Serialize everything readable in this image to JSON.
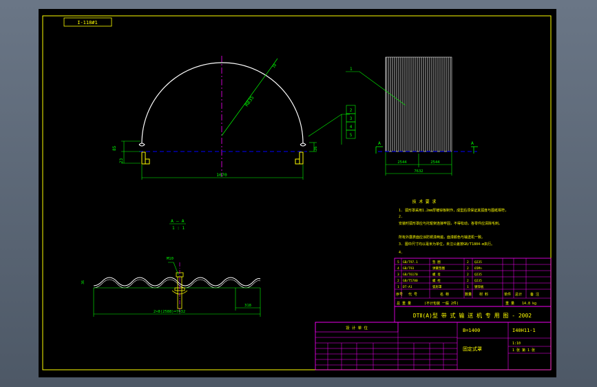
{
  "colors": {
    "frame": "#ffff00",
    "arc": "#ffffff",
    "green": "#00ff00",
    "center": "#ff00ff",
    "dash": "#0000ff",
    "table": "#ff00ff",
    "text": "#ffff00",
    "bg": "#000000",
    "desk": "#5a6676"
  },
  "drawing": {
    "code_box": "I-118#1",
    "dim_width": "1670",
    "dim_radius": "R835",
    "dim_left_1": "85",
    "dim_left_2": "23",
    "dim_right": "26",
    "dim_top_small": "10",
    "dim_plate_half_1": "2544",
    "dim_plate_half_2": "2544",
    "dim_plate_total": "7632",
    "section_mark_left": "A",
    "section_mark_right": "A",
    "section_title": "A — A",
    "section_scale": "1 : 1",
    "bolt_label": "M10",
    "wave_dim": "2×8(2588)=7632",
    "wave_end_dim": "318",
    "wave_height": "36",
    "callouts": [
      "1",
      "2",
      "3",
      "4",
      "5"
    ]
  },
  "notes": {
    "title": "技 术 要 求",
    "lines": [
      "1. 弧形罩采用1.2mm厚镀锌板制作，成型后须保证其弧度与图纸相符，",
      "2.",
      "   安装时弧形罩应与托辊架连接牢固，不得松动，各零件应清除毛刺。",
      "   所有外露表面应涂防锈漆两遍，面漆颜色与输送机一致。",
      "3. 图中尺寸均以毫米为单位，未注公差按GB/T1804-m执行。",
      "4."
    ]
  },
  "parts_table": {
    "rows": [
      [
        "5",
        "GB/T97.1",
        "垫 圈",
        "2",
        "Q235",
        "",
        "",
        ""
      ],
      [
        "4",
        "GB/T93",
        "弹簧垫圈",
        "2",
        "65Mn",
        "",
        "",
        ""
      ],
      [
        "3",
        "GB/T6170",
        "螺 母",
        "2",
        "Q235",
        "",
        "",
        ""
      ],
      [
        "2",
        "GB/T5780",
        "螺 栓",
        "2",
        "Q235",
        "",
        "",
        ""
      ],
      [
        "1",
        "DT-A1",
        "弧形罩",
        "1",
        "镀锌板",
        "",
        "",
        ""
      ]
    ],
    "header": [
      "序号",
      "代 号",
      "名 称",
      "数量",
      "材 料",
      "单件",
      "总计",
      "备 注"
    ],
    "totals": [
      "总 重 量",
      "(不计包装 一般 2件)",
      "重 量",
      "14.8 kg"
    ]
  },
  "title_block": {
    "product": "DTⅡ(A)型  带 式 输 送 机 专 用 图 - 2002",
    "width_spec": "B=1400",
    "drawing_no": "I40H11-1",
    "drawing_name": "固定式罩",
    "scale": "1:10",
    "sheet": "1 张 第 1 张",
    "design_header": "设 计 单 位"
  }
}
